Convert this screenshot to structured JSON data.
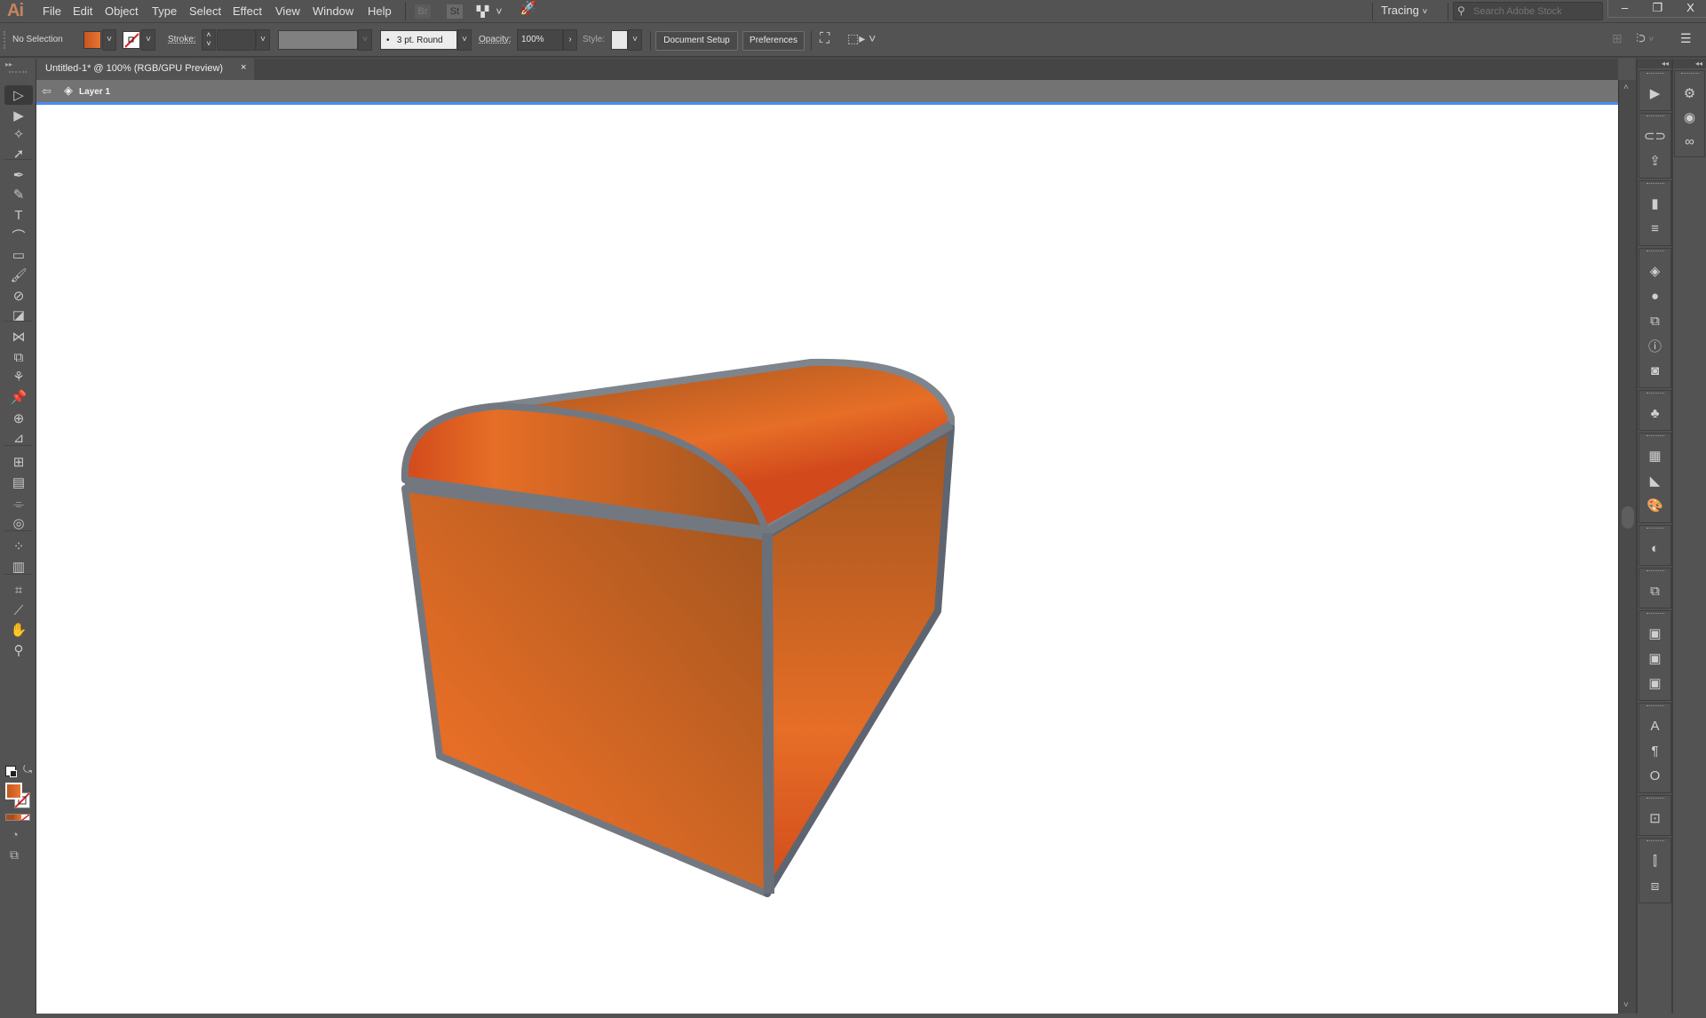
{
  "app": {
    "logo": "Ai",
    "menu": [
      "File",
      "Edit",
      "Object",
      "Type",
      "Select",
      "Effect",
      "View",
      "Window",
      "Help"
    ],
    "bridge_label": "Br",
    "stock_label": "St",
    "workspace": "Tracing",
    "search_placeholder": "Search Adobe Stock",
    "window_controls": {
      "minimize": "–",
      "restore": "❐",
      "close": "X"
    }
  },
  "control_bar": {
    "selection_status": "No Selection",
    "fill_color": "#e06a28",
    "stroke_label": "Stroke:",
    "stroke_weight": "",
    "brush_profile": "3 pt. Round",
    "opacity_label": "Opacity:",
    "opacity_value": "100%",
    "style_label": "Style:",
    "document_setup": "Document Setup",
    "preferences": "Preferences"
  },
  "document": {
    "tab_title": "Untitled-1* @ 100% (RGB/GPU Preview)",
    "close": "×",
    "layer_name": "Layer 1"
  },
  "tools": [
    {
      "name": "selection-tool",
      "glyph": "▷"
    },
    {
      "name": "direct-selection-tool",
      "glyph": "▶"
    },
    {
      "name": "magic-wand-tool",
      "glyph": "✧"
    },
    {
      "name": "lasso-tool",
      "glyph": "➚"
    },
    {
      "name": "pen-tool",
      "glyph": "✒"
    },
    {
      "name": "curvature-tool",
      "glyph": "✎"
    },
    {
      "name": "type-tool",
      "glyph": "T"
    },
    {
      "name": "line-segment-tool",
      "glyph": "⌒"
    },
    {
      "name": "rectangle-tool",
      "glyph": "▭"
    },
    {
      "name": "paintbrush-tool",
      "glyph": "🖌"
    },
    {
      "name": "shaper-tool",
      "glyph": "⊘"
    },
    {
      "name": "eraser-tool",
      "glyph": "◪"
    },
    {
      "name": "reflect-tool",
      "glyph": "⋈"
    },
    {
      "name": "scale-tool",
      "glyph": "⧉"
    },
    {
      "name": "puppet-warp-tool",
      "glyph": "⚘"
    },
    {
      "name": "pin-tool",
      "glyph": "📌"
    },
    {
      "name": "shape-builder-tool",
      "glyph": "⊕"
    },
    {
      "name": "perspective-grid-tool",
      "glyph": "⊿"
    },
    {
      "name": "mesh-tool",
      "glyph": "⊞"
    },
    {
      "name": "gradient-tool",
      "glyph": "▤"
    },
    {
      "name": "eyedropper-tool",
      "glyph": "⌯"
    },
    {
      "name": "blend-tool",
      "glyph": "◎"
    },
    {
      "name": "symbol-sprayer-tool",
      "glyph": "⁘"
    },
    {
      "name": "column-graph-tool",
      "glyph": "▥"
    },
    {
      "name": "artboard-tool",
      "glyph": "⌗"
    },
    {
      "name": "slice-tool",
      "glyph": "⟋"
    },
    {
      "name": "hand-tool",
      "glyph": "✋"
    },
    {
      "name": "zoom-tool",
      "glyph": "⚲"
    }
  ],
  "fill_stroke": {
    "fill": "#e06a28",
    "stroke": "none"
  },
  "right_panels": {
    "dock1": [
      "actions",
      "links",
      "asset-export",
      "gradient",
      "stroke",
      "layers",
      "appearance",
      "transform",
      "document-info",
      "image-trace",
      "symbols",
      "swatches",
      "color-guide",
      "color",
      "transparency",
      "pathfinder",
      "libraries-1",
      "libraries-2",
      "libraries-3",
      "character",
      "paragraph",
      "opentype",
      "artboards",
      "align",
      "navigator"
    ],
    "dock2": [
      "properties",
      "cc-libraries-sync",
      "creative-cloud"
    ]
  },
  "artwork": {
    "description": "orange treasure chest with gray trim",
    "fill_light": "#e66e26",
    "fill_dark": "#a0541f",
    "fill_red": "#d24a1c",
    "trim": "#737880"
  }
}
